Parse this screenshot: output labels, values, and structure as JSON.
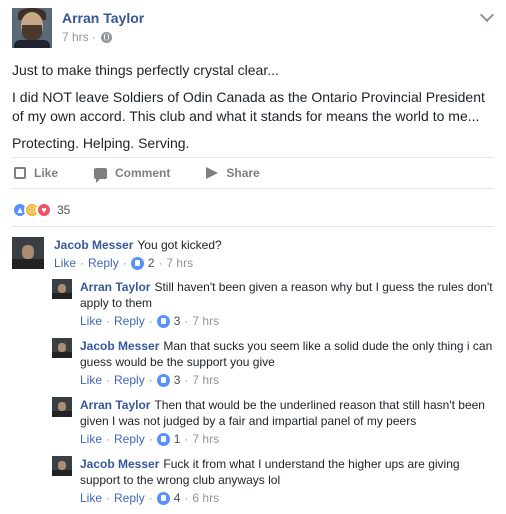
{
  "post": {
    "author": "Arran Taylor",
    "time": "7 hrs",
    "dot": "·",
    "paragraphs": [
      "Just to make things perfectly crystal clear...",
      "I did NOT leave Soldiers of Odin Canada as the Ontario Provincial President of my own accord. This club and what it stands for means the world to me...",
      "Protecting. Helping. Serving."
    ],
    "actions": {
      "like": "Like",
      "comment": "Comment",
      "share": "Share"
    },
    "reaction_count": "35"
  },
  "comments": [
    {
      "author": "Jacob Messer",
      "text": "You got kicked?",
      "like": "Like",
      "sep": "·",
      "reply": "Reply",
      "likes": "2",
      "time": "7 hrs"
    },
    {
      "author": "Arran Taylor",
      "text": "Still haven't been given a reason why but I guess the rules don't apply to them",
      "like": "Like",
      "sep": "·",
      "reply": "Reply",
      "likes": "3",
      "time": "7 hrs"
    },
    {
      "author": "Jacob Messer",
      "text": "Man that sucks you seem like a solid dude the only thing i can guess would be the support you give",
      "like": "Like",
      "sep": "·",
      "reply": "Reply",
      "likes": "3",
      "time": "7 hrs"
    },
    {
      "author": "Arran Taylor",
      "text": "Then that would be the underlined reason that still hasn't been given I was not judged by a fair and impartial panel of my peers",
      "like": "Like",
      "sep": "·",
      "reply": "Reply",
      "likes": "1",
      "time": "7 hrs"
    },
    {
      "author": "Jacob Messer",
      "text": "Fuck it from what I understand the higher ups are giving support to the wrong club anyways lol",
      "like": "Like",
      "sep": "·",
      "reply": "Reply",
      "likes": "4",
      "time": "6 hrs"
    }
  ],
  "colors": {
    "name_blue": "#365899",
    "link_blue": "#4267b2",
    "muted_gray": "#90949c",
    "like_reaction": "#5890ff",
    "sad_reaction": "#f7b125",
    "love_reaction": "#f25268"
  },
  "icons": [
    "avatar",
    "globe-icon",
    "chevron-down-icon",
    "like-icon",
    "comment-icon",
    "share-icon",
    "like-reaction-icon",
    "sad-reaction-icon",
    "love-reaction-icon"
  ]
}
